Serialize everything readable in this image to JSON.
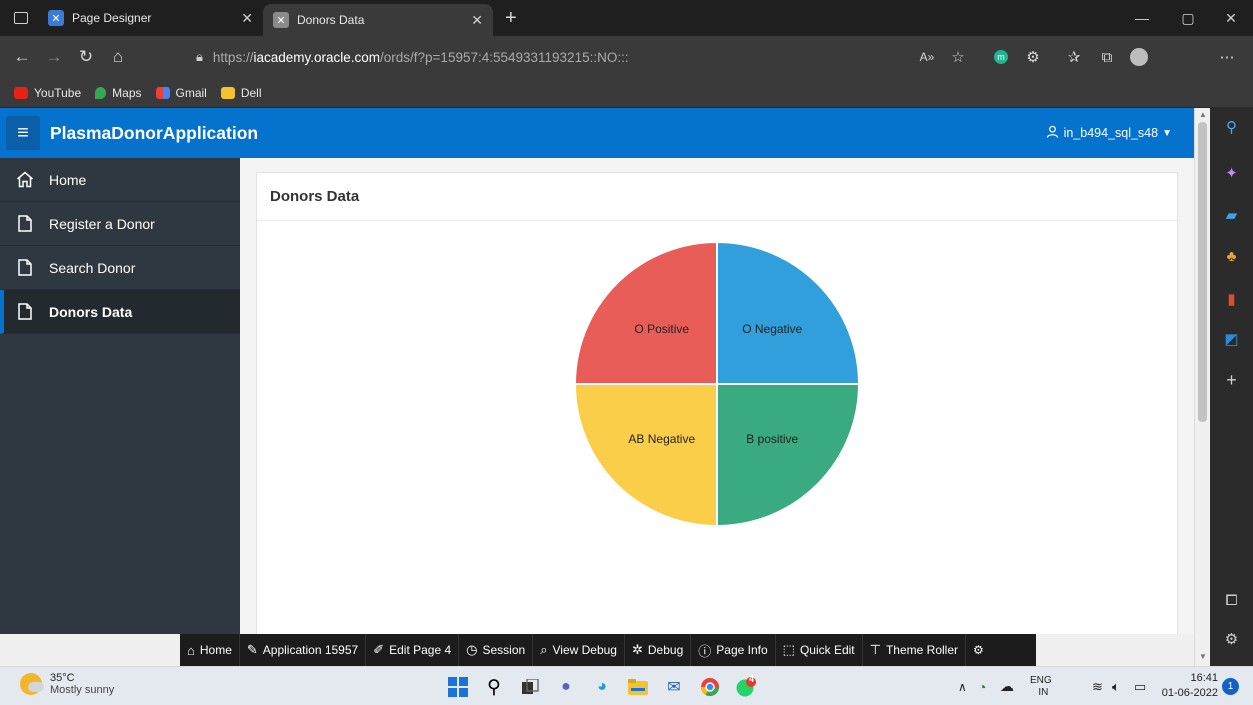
{
  "browser": {
    "tabs": [
      {
        "title": "Page Designer",
        "icon": "apex-icon",
        "active": false
      },
      {
        "title": "Donors Data",
        "icon": "apex-icon",
        "active": true
      }
    ],
    "new_tab": "+",
    "url": {
      "prefix": "https://",
      "host": "iacademy.oracle.com",
      "path": "/ords/f?p=15957:4:5549331193215::NO:::"
    },
    "bookmarks": [
      {
        "label": "YouTube",
        "color": "#e62117"
      },
      {
        "label": "Maps",
        "color": "#34a853"
      },
      {
        "label": "Gmail",
        "color": "#ea4335"
      },
      {
        "label": "Dell",
        "color": "#f4c430"
      }
    ]
  },
  "app": {
    "title": "PlasmaDonorApplication",
    "user": "in_b494_sql_s48",
    "brand_color": "#0572ce"
  },
  "sidebar": {
    "items": [
      {
        "label": "Home",
        "icon": "home-icon",
        "active": false
      },
      {
        "label": "Register a Donor",
        "icon": "page-icon",
        "active": false
      },
      {
        "label": "Search Donor",
        "icon": "page-icon",
        "active": false
      },
      {
        "label": "Donors Data",
        "icon": "page-icon",
        "active": true
      }
    ]
  },
  "region": {
    "title": "Donors Data"
  },
  "chart_data": {
    "type": "pie",
    "categories": [
      "O Negative",
      "B positive",
      "AB Negative",
      "O Positive"
    ],
    "values": [
      1,
      1,
      1,
      1
    ],
    "colors": [
      "#309fdb",
      "#3aaa80",
      "#fbce4a",
      "#e85d58"
    ],
    "title": "",
    "legend": "none"
  },
  "dev_toolbar": {
    "items": [
      {
        "label": "Home",
        "icon": "home-icon"
      },
      {
        "label": "Application 15957",
        "icon": "edit-app-icon"
      },
      {
        "label": "Edit Page 4",
        "icon": "edit-page-icon"
      },
      {
        "label": "Session",
        "icon": "clock-icon"
      },
      {
        "label": "View Debug",
        "icon": "view-debug-icon"
      },
      {
        "label": "Debug",
        "icon": "bug-icon"
      },
      {
        "label": "Page Info",
        "icon": "info-icon"
      },
      {
        "label": "Quick Edit",
        "icon": "quick-edit-icon"
      },
      {
        "label": "Theme Roller",
        "icon": "theme-roller-icon"
      }
    ]
  },
  "taskbar": {
    "weather_temp": "35°C",
    "weather_desc": "Mostly sunny",
    "language": "ENG",
    "region": "IN",
    "time": "16:41",
    "date": "01-06-2022",
    "notification_count": "1",
    "whatsapp_badge": "4"
  }
}
